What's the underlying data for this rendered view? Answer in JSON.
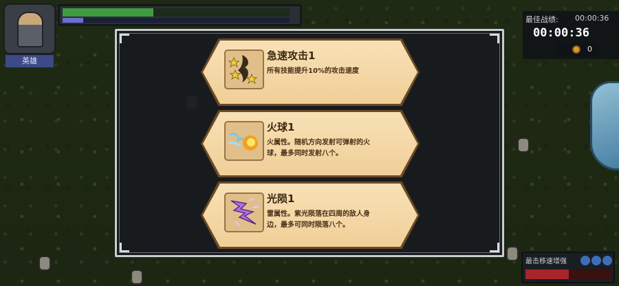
{
  "hud": {
    "player_name": "英雄",
    "hp_fraction": 0.4,
    "xp_fraction": 0.09,
    "best_label": "最佳战绩:",
    "best_value": "00:00:36",
    "timer": "00:00:36",
    "coins": "0",
    "skill_hint_label": "最击移速增强",
    "skill_hint_fill": 0.5
  },
  "cards": [
    {
      "title": "急速攻击1",
      "desc": "所有技能提升10%的攻击速度",
      "icon": "wind-stars-icon"
    },
    {
      "title": "火球1",
      "desc": "火属性。随机方向发射可弹射的火球，最多同时发射八个。",
      "icon": "fireball-icon"
    },
    {
      "title": "光陨1",
      "desc": "雷属性。紫光陨落在四周的敌人身边，最多可同时陨落八个。",
      "icon": "purple-lightning-icon"
    }
  ],
  "colors": {
    "card_bg": "#f1cf9a",
    "card_edge": "#6b4a24",
    "title_text": "#3a2610",
    "modal_bg": "#181b1f"
  }
}
